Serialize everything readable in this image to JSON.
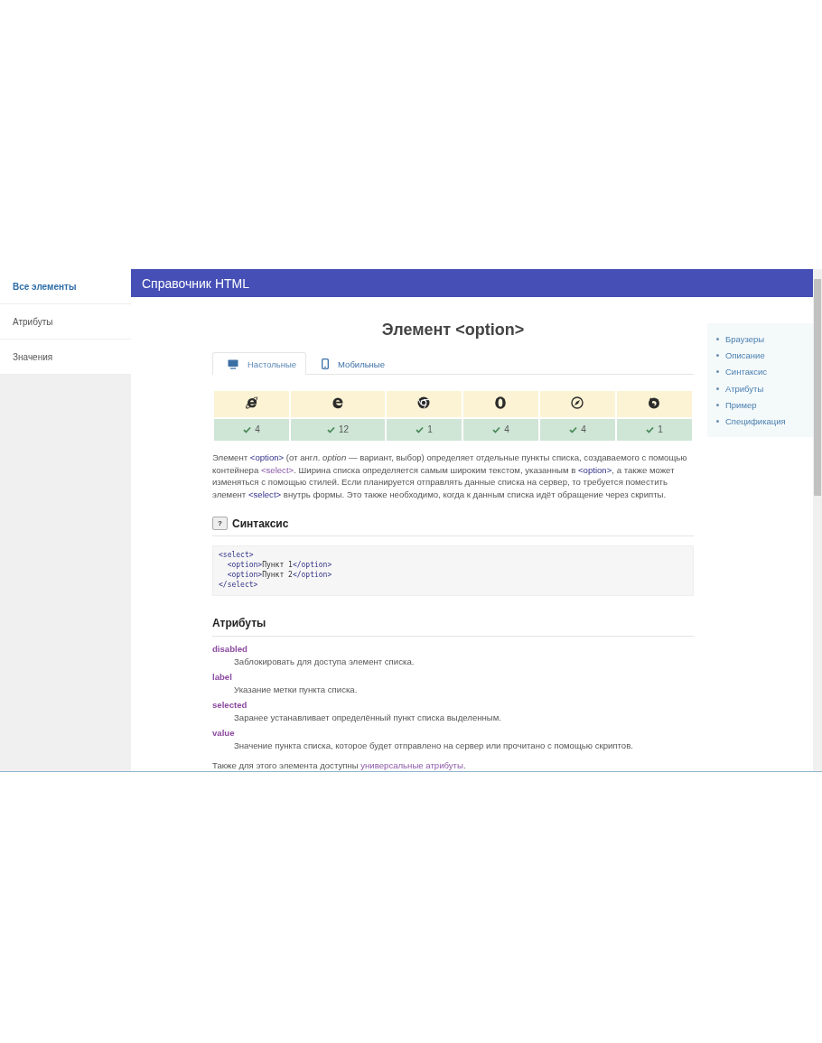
{
  "sidebar": {
    "items": [
      {
        "label": "Все элементы",
        "selected": true
      },
      {
        "label": "Атрибуты",
        "selected": false
      },
      {
        "label": "Значения",
        "selected": false
      }
    ]
  },
  "header": {
    "title": "Справочник HTML"
  },
  "title": "Элемент <option>",
  "tabs": [
    {
      "label": "Настольные",
      "kind": "desktop",
      "selected": true
    },
    {
      "label": "Мобильные",
      "kind": "mobile",
      "selected": false
    }
  ],
  "browsers": [
    {
      "kind": "ie",
      "version": "4"
    },
    {
      "kind": "edge",
      "version": "12"
    },
    {
      "kind": "chrome",
      "version": "1"
    },
    {
      "kind": "opera",
      "version": "4"
    },
    {
      "kind": "safari",
      "version": "4"
    },
    {
      "kind": "firefox",
      "version": "1"
    }
  ],
  "description": [
    {
      "kind": "text",
      "text": "Элемент "
    },
    {
      "kind": "link",
      "text": "<option>",
      "visited": false
    },
    {
      "kind": "text",
      "text": " (от англ. "
    },
    {
      "kind": "em",
      "text": "option"
    },
    {
      "kind": "text",
      "text": " — вариант, выбор) определяет отдельные пункты списка, создаваемого с помощью контейнера "
    },
    {
      "kind": "link",
      "text": "<select>",
      "visited": true
    },
    {
      "kind": "text",
      "text": ". Ширина списка определяется самым широким текстом, указанным в "
    },
    {
      "kind": "link",
      "text": "<option>",
      "visited": false
    },
    {
      "kind": "text",
      "text": ", а также может изменяться с помощью стилей. Если планируется отправлять данные списка на сервер, то требуется поместить элемент "
    },
    {
      "kind": "link",
      "text": "<select>",
      "visited": false
    },
    {
      "kind": "text",
      "text": " внутрь формы. Это также необходимо, когда к данным списка идёт обращение через скрипты."
    }
  ],
  "syntax": {
    "badge": "?",
    "heading": "Синтаксис",
    "code": [
      [
        {
          "kind": "tag",
          "text": "<select>"
        }
      ],
      [
        {
          "kind": "tag",
          "text": "  <option>"
        },
        {
          "kind": "text",
          "text": "Пункт 1"
        },
        {
          "kind": "tag",
          "text": "</option>"
        }
      ],
      [
        {
          "kind": "tag",
          "text": "  <option>"
        },
        {
          "kind": "text",
          "text": "Пункт 2"
        },
        {
          "kind": "tag",
          "text": "</option>"
        }
      ],
      [
        {
          "kind": "tag",
          "text": "</select>"
        }
      ]
    ]
  },
  "attributes": {
    "heading": "Атрибуты",
    "items": [
      {
        "name": "disabled",
        "description": "Заблокировать для доступа элемент списка."
      },
      {
        "name": "label",
        "description": "Указание метки пункта списка."
      },
      {
        "name": "selected",
        "description": "Заранее устанавливает определённый пункт списка выделенным."
      },
      {
        "name": "value",
        "description": "Значение пункта списка, которое будет отправлено на сервер или прочитано с помощью скриптов."
      }
    ],
    "note": [
      {
        "kind": "text",
        "text": "Также для этого элемента доступны "
      },
      {
        "kind": "link",
        "text": "универсальные атрибуты",
        "visited": true
      },
      {
        "kind": "text",
        "text": "."
      }
    ]
  },
  "toc": [
    "Браузеры",
    "Описание",
    "Синтаксис",
    "Атрибуты",
    "Пример",
    "Спецификация"
  ]
}
